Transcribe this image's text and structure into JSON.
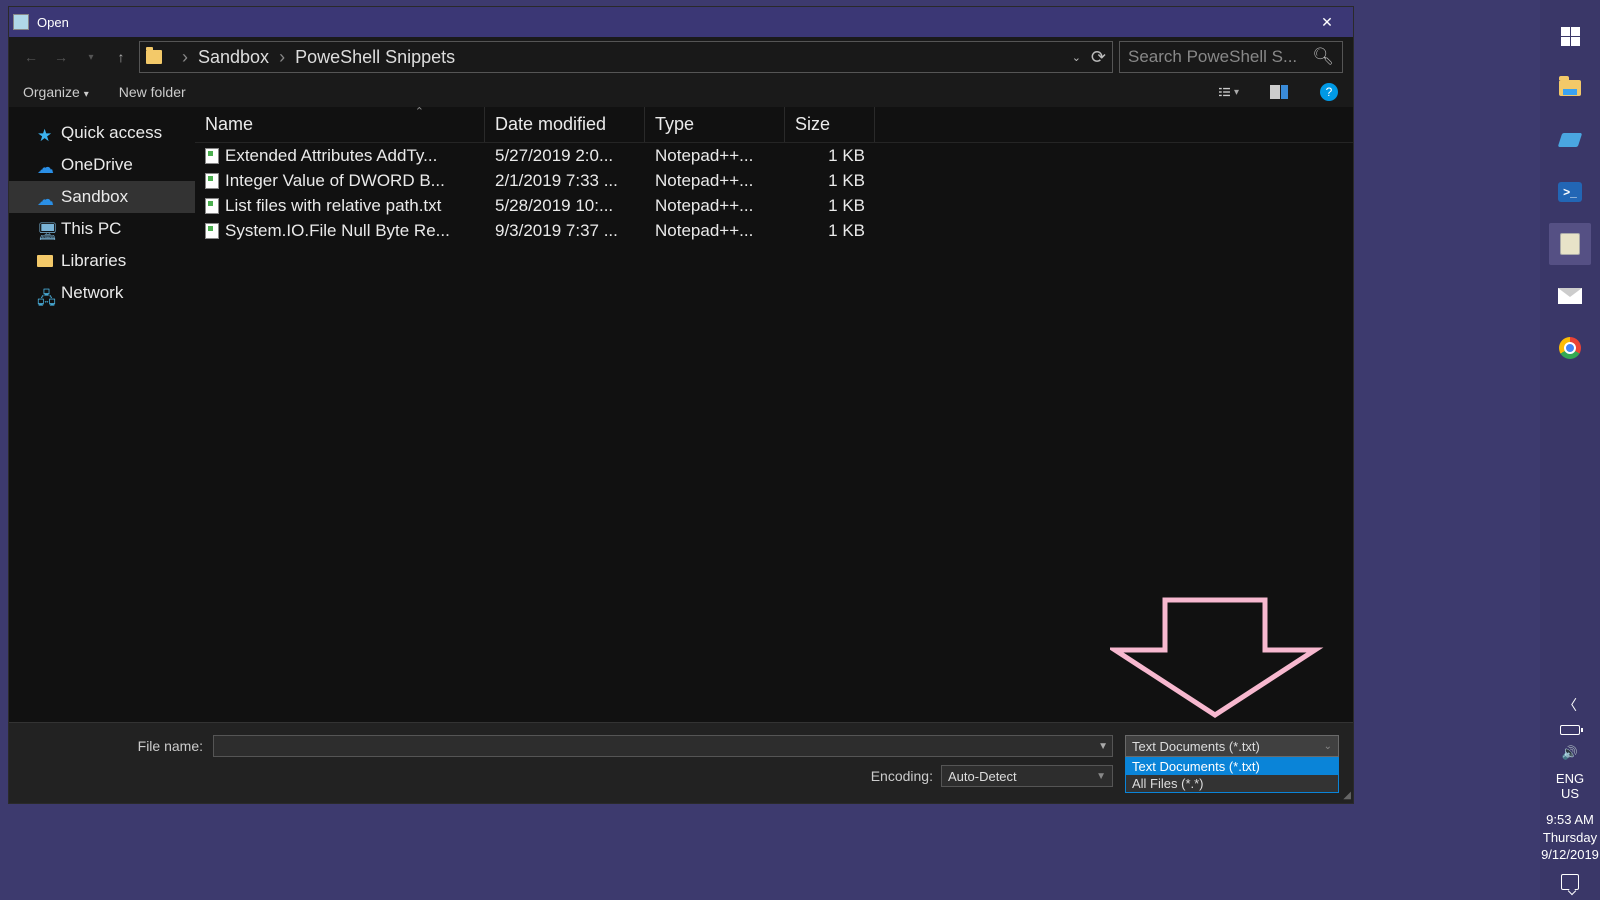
{
  "dialog": {
    "title": "Open",
    "breadcrumb": [
      "Sandbox",
      "PoweShell Snippets"
    ],
    "search_placeholder": "Search PoweShell S...",
    "toolbar": {
      "organize": "Organize",
      "newfolder": "New folder"
    },
    "sidebar": [
      {
        "label": "Quick access",
        "icon": "star"
      },
      {
        "label": "OneDrive",
        "icon": "cloud"
      },
      {
        "label": "Sandbox",
        "icon": "cloud",
        "selected": true
      },
      {
        "label": "This PC",
        "icon": "pc"
      },
      {
        "label": "Libraries",
        "icon": "lib"
      },
      {
        "label": "Network",
        "icon": "net"
      }
    ],
    "columns": {
      "name": "Name",
      "date": "Date modified",
      "type": "Type",
      "size": "Size"
    },
    "files": [
      {
        "name": "Extended Attributes AddTy...",
        "date": "5/27/2019 2:0...",
        "type": "Notepad++...",
        "size": "1 KB"
      },
      {
        "name": "Integer Value of DWORD B...",
        "date": "2/1/2019 7:33 ...",
        "type": "Notepad++...",
        "size": "1 KB"
      },
      {
        "name": "List files with relative path.txt",
        "date": "5/28/2019 10:...",
        "type": "Notepad++...",
        "size": "1 KB"
      },
      {
        "name": "System.IO.File Null Byte Re...",
        "date": "9/3/2019 7:37 ...",
        "type": "Notepad++...",
        "size": "1 KB"
      }
    ],
    "footer": {
      "filename_label": "File name:",
      "filename_value": "",
      "encoding_label": "Encoding:",
      "encoding_value": "Auto-Detect",
      "filetype_selected": "Text Documents (*.txt)",
      "filetype_options": [
        "Text Documents (*.txt)",
        "All Files  (*.*)"
      ]
    }
  },
  "taskbar": {
    "tray": {
      "lang1": "ENG",
      "lang2": "US",
      "time": "9:53 AM",
      "day": "Thursday",
      "date": "9/12/2019"
    }
  }
}
